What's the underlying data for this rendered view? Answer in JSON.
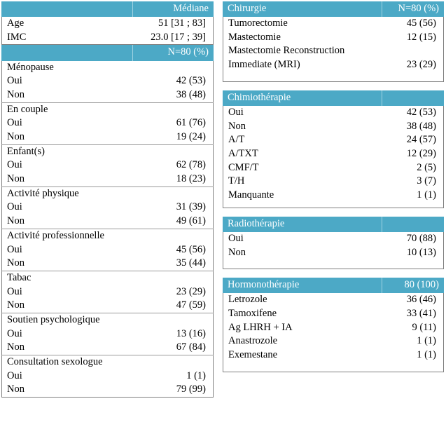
{
  "document": {
    "type": "clinical-characteristics-table",
    "accent_color": "#4CA9C6",
    "header_text_color": "#FFFFFF",
    "body_text_color": "#000000",
    "border_color": "#808080"
  },
  "left_table": {
    "header_median": {
      "label": "",
      "value": "Médiane"
    },
    "continuous_rows": [
      {
        "label": "Age",
        "value": "51 [31 ; 83]"
      },
      {
        "label": "IMC",
        "value": "23.0 [17 ; 39]"
      }
    ],
    "header_n": {
      "label": "",
      "value": "N=80 (%)"
    },
    "groups": [
      {
        "title": "Ménopause",
        "rows": [
          {
            "label": "Oui",
            "value": "42 (53)"
          },
          {
            "label": "Non",
            "value": "38 (48)"
          }
        ]
      },
      {
        "title": "En couple",
        "rows": [
          {
            "label": "Oui",
            "value": "61 (76)"
          },
          {
            "label": "Non",
            "value": "19 (24)"
          }
        ]
      },
      {
        "title": "Enfant(s)",
        "rows": [
          {
            "label": "Oui",
            "value": "62 (78)"
          },
          {
            "label": "Non",
            "value": "18 (23)"
          }
        ]
      },
      {
        "title": "Activité physique",
        "rows": [
          {
            "label": "Oui",
            "value": "31 (39)"
          },
          {
            "label": "Non",
            "value": "49 (61)"
          }
        ]
      },
      {
        "title": "Activité professionnelle",
        "rows": [
          {
            "label": "Oui",
            "value": "45 (56)"
          },
          {
            "label": "Non",
            "value": "35 (44)"
          }
        ]
      },
      {
        "title": "Tabac",
        "rows": [
          {
            "label": "Oui",
            "value": "23 (29)"
          },
          {
            "label": "Non",
            "value": "47 (59)"
          }
        ]
      },
      {
        "title": "Soutien psychologique",
        "rows": [
          {
            "label": "Oui",
            "value": "13 (16)"
          },
          {
            "label": "Non",
            "value": "67 (84)"
          }
        ]
      },
      {
        "title": "Consultation sexologue",
        "rows": [
          {
            "label": "Oui",
            "value": "1 (1)"
          },
          {
            "label": "Non",
            "value": "79 (99)"
          }
        ]
      }
    ]
  },
  "right_table": {
    "blocks": [
      {
        "header": {
          "label": "Chirurgie",
          "value": "N=80 (%)"
        },
        "rows": [
          {
            "label": "Tumorectomie",
            "value": "45 (56)"
          },
          {
            "label": "Mastectomie",
            "value": "12 (15)"
          },
          {
            "label": "Mastectomie Reconstruction",
            "value": ""
          },
          {
            "label": "Immediate (MRI)",
            "value": "23 (29)"
          }
        ]
      },
      {
        "header": {
          "label": "Chimiothérapie",
          "value": ""
        },
        "rows": [
          {
            "label": "Oui",
            "value": "42 (53)"
          },
          {
            "label": "Non",
            "value": "38 (48)"
          },
          {
            "label": "A/T",
            "value": "24 (57)"
          },
          {
            "label": "A/TXT",
            "value": "12 (29)"
          },
          {
            "label": "CMF/T",
            "value": "2 (5)"
          },
          {
            "label": "T/H",
            "value": "3 (7)"
          },
          {
            "label": "Manquante",
            "value": "1 (1)"
          }
        ]
      },
      {
        "header": {
          "label": "Radiothérapie",
          "value": ""
        },
        "rows": [
          {
            "label": "Oui",
            "value": "70 (88)"
          },
          {
            "label": "Non",
            "value": "10 (13)"
          }
        ]
      },
      {
        "header": {
          "label": "Hormonothérapie",
          "value": "80 (100)"
        },
        "rows": [
          {
            "label": "Letrozole",
            "value": "36 (46)"
          },
          {
            "label": "Tamoxifene",
            "value": "33 (41)"
          },
          {
            "label": "Ag LHRH + IA",
            "value": "9 (11)"
          },
          {
            "label": "Anastrozole",
            "value": "1 (1)"
          },
          {
            "label": "Exemestane",
            "value": "1 (1)"
          }
        ]
      }
    ]
  }
}
